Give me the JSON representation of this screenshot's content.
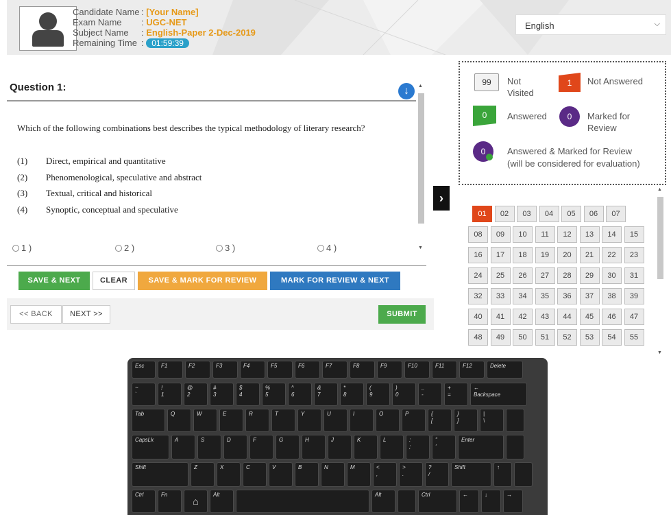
{
  "header": {
    "candidate_label": "Candidate Name",
    "candidate_value": "[Your Name]",
    "exam_label": "Exam Name",
    "exam_value": "UGC-NET",
    "subject_label": "Subject Name",
    "subject_value": "English-Paper 2-Dec-2019",
    "time_label": "Remaining Time",
    "time_value": "01:59:39",
    "language": "English"
  },
  "question": {
    "title": "Question 1:",
    "text": "Which of the following combinations best describes the typical methodology of literary research?",
    "options": [
      {
        "num": "(1)",
        "text": "Direct, empirical and quantitative"
      },
      {
        "num": "(2)",
        "text": "Phenomenological, speculative and abstract"
      },
      {
        "num": "(3)",
        "text": "Textual, critical and historical"
      },
      {
        "num": "(4)",
        "text": "Synoptic, conceptual and speculative"
      }
    ],
    "answers": [
      "1 )",
      "2 )",
      "3 )",
      "4 )"
    ]
  },
  "actions": {
    "save_next": "SAVE & NEXT",
    "clear": "CLEAR",
    "save_mark_review": "SAVE & MARK FOR REVIEW",
    "mark_review_next": "MARK FOR REVIEW & NEXT",
    "back": "<< BACK",
    "next": "NEXT >>",
    "submit": "SUBMIT"
  },
  "legend": {
    "not_visited_count": "99",
    "not_visited_label": "Not Visited",
    "not_answered_count": "1",
    "not_answered_label": "Not Answered",
    "answered_count": "0",
    "answered_label": "Answered",
    "marked_count": "0",
    "marked_label": "Marked for Review",
    "answered_marked_count": "0",
    "answered_marked_label": "Answered & Marked for Review",
    "answered_marked_note": "(will be considered for evaluation)"
  },
  "palette": {
    "current": "01",
    "numbers": [
      "01",
      "02",
      "03",
      "04",
      "05",
      "06",
      "07",
      "08",
      "09",
      "10",
      "11",
      "12",
      "13",
      "14",
      "15",
      "16",
      "17",
      "18",
      "19",
      "20",
      "21",
      "22",
      "23",
      "24",
      "25",
      "26",
      "27",
      "28",
      "29",
      "30",
      "31",
      "32",
      "33",
      "34",
      "35",
      "36",
      "37",
      "38",
      "39",
      "40",
      "41",
      "42",
      "43",
      "44",
      "45",
      "46",
      "47",
      "48",
      "49",
      "50",
      "51",
      "52",
      "53",
      "54",
      "55"
    ]
  },
  "colors": {
    "not_answered": "#e0471a",
    "answered": "#3aa53a",
    "marked": "#5a2a86",
    "accent_blue": "#2f79c0",
    "time_badge": "#2aa0c9",
    "header_value": "#e69a1a"
  },
  "keyboard": {
    "rows": [
      [
        "Esc",
        "F1",
        "F2",
        "F3",
        "F4",
        "F5",
        "F6",
        "F7",
        "F8",
        "F9",
        "F10",
        "F11",
        "F12",
        "Delete"
      ],
      [
        "~\n`",
        "!\n1",
        "@\n2",
        "#\n3",
        "$\n4",
        "%\n5",
        "^\n6",
        "&\n7",
        "*\n8",
        "(\n9",
        ")\n0",
        "_\n-",
        "+\n=",
        "←\nBackspace"
      ],
      [
        "Tab",
        "Q",
        "W",
        "E",
        "R",
        "T",
        "Y",
        "U",
        "I",
        "O",
        "P",
        "{\n[",
        "}\n]",
        "|\n\\",
        ""
      ],
      [
        "CapsLk",
        "A",
        "S",
        "D",
        "F",
        "G",
        "H",
        "J",
        "K",
        "L",
        ":\n;",
        "\"\n'",
        "Enter",
        ""
      ],
      [
        "Shift",
        "Z",
        "X",
        "C",
        "V",
        "B",
        "N",
        "M",
        "<\n,",
        ">\n.",
        "?\n/",
        "Shift",
        "↑",
        ""
      ],
      [
        "Ctrl",
        "Fn",
        "",
        "Alt",
        "",
        "Alt",
        "",
        "Ctrl",
        "←",
        "↓",
        "→"
      ]
    ]
  }
}
